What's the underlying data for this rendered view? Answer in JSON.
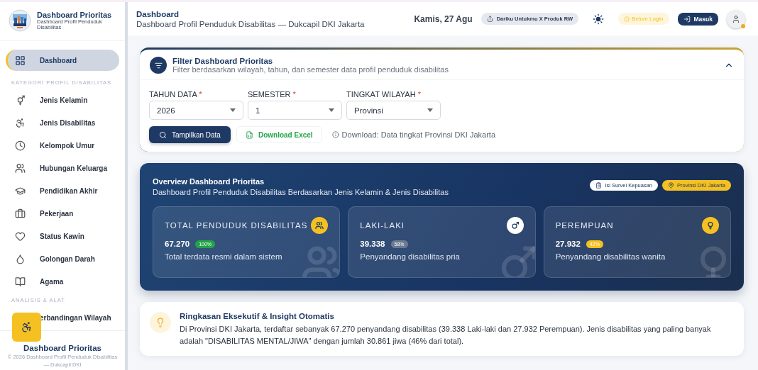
{
  "sidebar": {
    "brand": {
      "title": "Dashboard Prioritas",
      "subtitle": "Dashboard Profil Penduduk Disabilitas"
    },
    "main_item": {
      "label": "Dashboard",
      "selected": true
    },
    "sections": [
      {
        "title": "KATEGORI PROFIL DISABILITAS",
        "items": [
          {
            "label": "Jenis Kelamin",
            "selected": false
          },
          {
            "label": "Jenis Disabilitas",
            "selected": false
          },
          {
            "label": "Kelompok Umur",
            "selected": false
          },
          {
            "label": "Hubungan Keluarga",
            "selected": false
          },
          {
            "label": "Pendidikan Akhir",
            "selected": false
          },
          {
            "label": "Pekerjaan",
            "selected": false
          },
          {
            "label": "Status Kawin",
            "selected": false
          },
          {
            "label": "Golongan Darah",
            "selected": false
          },
          {
            "label": "Agama",
            "selected": false
          }
        ]
      },
      {
        "title": "ANALISIS & ALAT",
        "items": [
          {
            "label": "erbandingan Wilayah",
            "selected": false
          }
        ]
      }
    ],
    "footer": {
      "title": "Dashboard Prioritas",
      "copyright": "© 2026 Dashboard Profil Penduduk Disabilitas — Dukcapil DKI"
    }
  },
  "header": {
    "title": "Dashboard",
    "subtitle": "Dashboard Profil Penduduk Disabilitas — Dukcapil DKI Jakarta",
    "date": "Kamis, 27 Agu",
    "chip": "Dariku Untukmu X Produk RW",
    "login_status": "Belum Login",
    "login_button": "Masuk"
  },
  "filter": {
    "title": "Filter Dashboard Prioritas",
    "subtitle": "Filter berdasarkan wilayah, tahun, dan semester data profil penduduk disabilitas",
    "expanded": true,
    "fields": [
      {
        "label": "TAHUN DATA",
        "required": "*",
        "value": "2026"
      },
      {
        "label": "SEMESTER",
        "required": "*",
        "value": "1"
      },
      {
        "label": "TINGKAT WILAYAH",
        "required": "*",
        "value": "Provinsi"
      }
    ],
    "show_button": "Tampilkan Data",
    "download_button": "Download Excel",
    "download_note": "Download: Data tingkat Provinsi DKI Jakarta"
  },
  "overview": {
    "title": "Overview Dashboard Prioritas",
    "subtitle": "Dashboard Profil Penduduk Disabilitas Berdasarkan Jenis Kelamin & Jenis Disabilitas",
    "survey_button": "Isi Survei Kepuasan",
    "region_chip": "Provinsi DKI Jakarta",
    "stats": [
      {
        "kind": "total",
        "label": "TOTAL PENDUDUK DISABILITAS",
        "value": "67.270",
        "percent": "100%",
        "color": "#22a447",
        "description": "Total terdata resmi dalam sistem"
      },
      {
        "kind": "male",
        "label": "LAKI-LAKI",
        "value": "39.338",
        "percent": "58%",
        "color": "#6b7a90",
        "description": "Penyandang disabilitas pria"
      },
      {
        "kind": "female",
        "label": "PEREMPUAN",
        "value": "27.932",
        "percent": "42%",
        "color": "#f5c021",
        "description": "Penyandang disabilitas wanita"
      }
    ]
  },
  "insight": {
    "title": "Ringkasan Eksekutif & Insight Otomatis",
    "text": "Di Provinsi DKI Jakarta, terdaftar sebanyak 67.270 penyandang disabilitas (39.338 Laki-laki dan 27.932 Perempuan). Jenis disabilitas yang paling banyak adalah \"DISABILITAS MENTAL/JIWA\" dengan jumlah 30.861 jiwa (46% dari total)."
  }
}
